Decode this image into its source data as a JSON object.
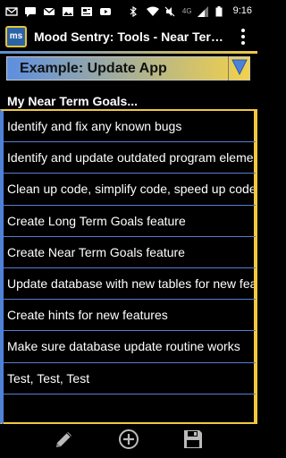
{
  "status_bar": {
    "time": "9:16",
    "left_icons": [
      "mail-icon",
      "message-icon",
      "gmail-icon",
      "image-icon",
      "news-icon",
      "youtube-icon"
    ],
    "right_icons": [
      "bluetooth-icon",
      "wifi-icon",
      "mute-icon",
      "lte-icon",
      "signal-icon",
      "battery-icon"
    ],
    "network_label": "4G"
  },
  "app_bar": {
    "icon_text": "ms",
    "title": "Mood Sentry: Tools - Near Term Goals"
  },
  "selector": {
    "value": "Example: Update App"
  },
  "section": {
    "title": "My Near Term Goals..."
  },
  "goals": [
    "Identify and fix any known bugs",
    "Identify and update outdated program elements",
    "Clean up code, simplify code, speed up code",
    "Create Long Term Goals feature",
    "Create Near Term Goals feature",
    "Update database with new tables for new features",
    "Create hints for new features",
    "Make sure database update routine works",
    "Test, Test, Test",
    ""
  ],
  "bottom_bar": {
    "buttons": [
      "edit-icon",
      "add-circle-icon",
      "save-icon"
    ]
  },
  "colors": {
    "accent_blue": "#4e82d8",
    "accent_yellow": "#f1c840",
    "background": "#000000"
  }
}
